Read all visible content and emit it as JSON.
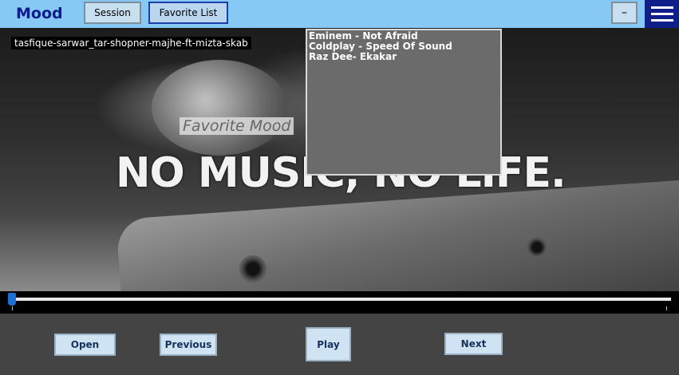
{
  "header": {
    "title": "Mood",
    "session_label": "Session",
    "favorite_list_label": "Favorite List",
    "minimize_label": "–"
  },
  "now_playing": {
    "track_name": "tasfique-sarwar_tar-shopner-majhe-ft-mizta-skab"
  },
  "background_slogan": "NO MUSIC, NO LIFE.",
  "favorite_mood_label": "Favorite Mood",
  "playlist": {
    "items": [
      "Eminem - Not Afraid",
      "Coldplay - Speed Of Sound",
      "Raz Dee- Ekakar"
    ]
  },
  "seek": {
    "position_fraction": 0.0
  },
  "controls": {
    "open_label": "Open",
    "previous_label": "Previous",
    "play_label": "Play",
    "next_label": "Next"
  },
  "colors": {
    "topbar": "#87c9f5",
    "title": "#0a1d8c",
    "menu": "#0f1f8a",
    "seek_thumb": "#1b6fd6"
  },
  "icons": {
    "menu": "hamburger-icon"
  }
}
